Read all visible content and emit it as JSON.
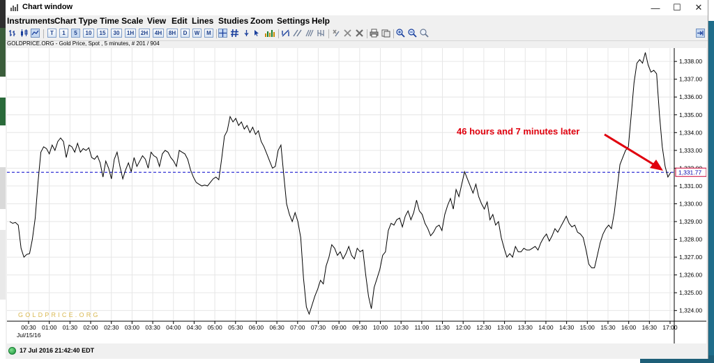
{
  "window": {
    "title": "Chart window",
    "minimize": "—",
    "maximize": "☐",
    "close": "✕"
  },
  "menu": [
    "Instruments",
    "Chart Type",
    "Time Scale",
    "View",
    "Edit",
    "Lines",
    "Studies",
    "Zoom",
    "Settings",
    "Help"
  ],
  "toolbar": {
    "timeframes": [
      "T",
      "1",
      "5",
      "10",
      "15",
      "30",
      "1H",
      "2H",
      "4H",
      "8H",
      "D",
      "W",
      "M"
    ],
    "icons": [
      "bar-chart-icon",
      "candlestick-icon",
      "line-chart-icon",
      "crosshair-icon",
      "grid-icon",
      "marker-icon",
      "cursor-icon",
      "volume-icon",
      "trendline-icon",
      "parallel-lines-icon",
      "fibonacci-icon",
      "cycle-lines-icon",
      "delete-selected-icon",
      "delete-all-icon",
      "print-icon",
      "copy-icon",
      "zoom-in-icon",
      "zoom-out-icon",
      "zoom-fit-icon",
      "settings-icon"
    ]
  },
  "chart": {
    "header": "GOLDPRICE.ORG - Gold Price, Spot , 5 minutes, # 201 / 904",
    "watermark": "GOLDPRICE.ORG",
    "date_label": "Jul/15/16",
    "annotation": "46 hours and 7 minutes later",
    "price_badge": "1,331.77",
    "colors": {
      "line": "#000000",
      "reference": "#0000cc",
      "annotation": "#e0000e",
      "grid": "#e6e6e6",
      "watermark": "#d9b850"
    }
  },
  "chart_data": {
    "type": "line",
    "title": "GOLDPRICE.ORG - Gold Price, Spot , 5 minutes, # 201 / 904",
    "xlabel": "",
    "ylabel": "",
    "ylim": [
      1323.4,
      1338.75
    ],
    "x_ticks": [
      "00:30",
      "01:00",
      "01:30",
      "02:00",
      "02:30",
      "03:00",
      "03:30",
      "04:00",
      "04:30",
      "05:00",
      "05:30",
      "06:00",
      "06:30",
      "07:00",
      "07:30",
      "09:00",
      "09:30",
      "10:00",
      "10:30",
      "11:00",
      "11:30",
      "12:00",
      "12:30",
      "13:00",
      "13:30",
      "14:00",
      "14:30",
      "15:00",
      "15:30",
      "16:00",
      "16:30",
      "17:00"
    ],
    "y_ticks": [
      "1,324.00",
      "1,325.00",
      "1,326.00",
      "1,327.00",
      "1,328.00",
      "1,329.00",
      "1,330.00",
      "1,331.00",
      "1,332.00",
      "1,333.00",
      "1,334.00",
      "1,335.00",
      "1,336.00",
      "1,337.00",
      "1,338.00"
    ],
    "y_tick_values": [
      1324,
      1325,
      1326,
      1327,
      1328,
      1329,
      1330,
      1331,
      1332,
      1333,
      1334,
      1335,
      1336,
      1337,
      1338
    ],
    "reference_line": 1331.77,
    "grid": true,
    "series": [
      {
        "values": [
          1329.0,
          1328.9,
          1328.95,
          1328.8,
          1327.5,
          1327.0,
          1327.15,
          1327.2,
          1328.0,
          1329.2,
          1331.2,
          1332.9,
          1333.2,
          1333.1,
          1332.8,
          1333.3,
          1333.0,
          1333.5,
          1333.7,
          1333.5,
          1332.6,
          1333.3,
          1333.2,
          1332.9,
          1333.4,
          1332.9,
          1333.1,
          1333.0,
          1333.15,
          1332.6,
          1332.5,
          1332.7,
          1332.3,
          1331.5,
          1332.4,
          1332.0,
          1331.4,
          1332.5,
          1332.9,
          1332.1,
          1331.4,
          1331.9,
          1332.3,
          1331.8,
          1332.6,
          1332.1,
          1332.4,
          1332.7,
          1332.5,
          1332.0,
          1332.9,
          1332.7,
          1332.6,
          1332.1,
          1332.8,
          1333.0,
          1332.9,
          1332.6,
          1332.4,
          1332.1,
          1333.0,
          1332.9,
          1332.8,
          1332.5,
          1331.9,
          1331.5,
          1331.2,
          1331.1,
          1331.0,
          1331.05,
          1331.0,
          1331.2,
          1331.4,
          1331.5,
          1331.35,
          1332.5,
          1333.8,
          1334.1,
          1334.9,
          1334.6,
          1334.8,
          1334.4,
          1334.6,
          1334.2,
          1334.4,
          1334.0,
          1334.3,
          1333.9,
          1334.1,
          1333.5,
          1333.2,
          1332.8,
          1332.4,
          1332.0,
          1332.1,
          1333.0,
          1333.3,
          1331.6,
          1330.0,
          1329.4,
          1329.0,
          1329.5,
          1329.0,
          1328.1,
          1325.8,
          1324.2,
          1323.8,
          1324.3,
          1324.8,
          1325.2,
          1325.7,
          1325.5,
          1326.5,
          1327.0,
          1327.7,
          1327.5,
          1327.1,
          1327.3,
          1326.9,
          1327.2,
          1327.6,
          1327.1,
          1326.9,
          1327.5,
          1327.3,
          1327.4,
          1326.0,
          1324.8,
          1324.1,
          1325.3,
          1325.8,
          1326.3,
          1327.1,
          1327.3,
          1328.5,
          1328.9,
          1328.8,
          1329.1,
          1329.2,
          1328.7,
          1329.3,
          1329.6,
          1329.1,
          1329.5,
          1330.2,
          1329.6,
          1329.4,
          1328.9,
          1328.6,
          1328.2,
          1328.4,
          1328.7,
          1328.8,
          1328.5,
          1329.4,
          1329.9,
          1330.3,
          1329.7,
          1330.8,
          1330.4,
          1331.1,
          1331.8,
          1331.4,
          1331.0,
          1330.6,
          1331.1,
          1330.4,
          1330.0,
          1329.7,
          1330.1,
          1329.1,
          1329.4,
          1328.8,
          1329.0,
          1328.1,
          1327.5,
          1327.0,
          1327.2,
          1327.0,
          1327.6,
          1327.3,
          1327.3,
          1327.5,
          1327.4,
          1327.4,
          1327.5,
          1327.6,
          1327.4,
          1327.8,
          1328.1,
          1328.3,
          1327.9,
          1328.2,
          1328.6,
          1328.4,
          1328.7,
          1329.0,
          1329.3,
          1328.9,
          1328.7,
          1328.8,
          1328.4,
          1328.3,
          1328.1,
          1327.4,
          1326.6,
          1326.4,
          1326.4,
          1327.1,
          1327.8,
          1328.3,
          1328.6,
          1328.8,
          1328.6,
          1329.5,
          1330.8,
          1332.2,
          1332.6,
          1333.0,
          1333.2,
          1335.0,
          1336.8,
          1337.9,
          1338.1,
          1337.9,
          1338.5,
          1337.8,
          1337.4,
          1337.5,
          1337.3,
          1335.0,
          1333.2,
          1332.1,
          1331.5,
          1331.77
        ]
      }
    ]
  },
  "status": {
    "timestamp": "17 Jul 2016 21:42:40 EDT"
  }
}
